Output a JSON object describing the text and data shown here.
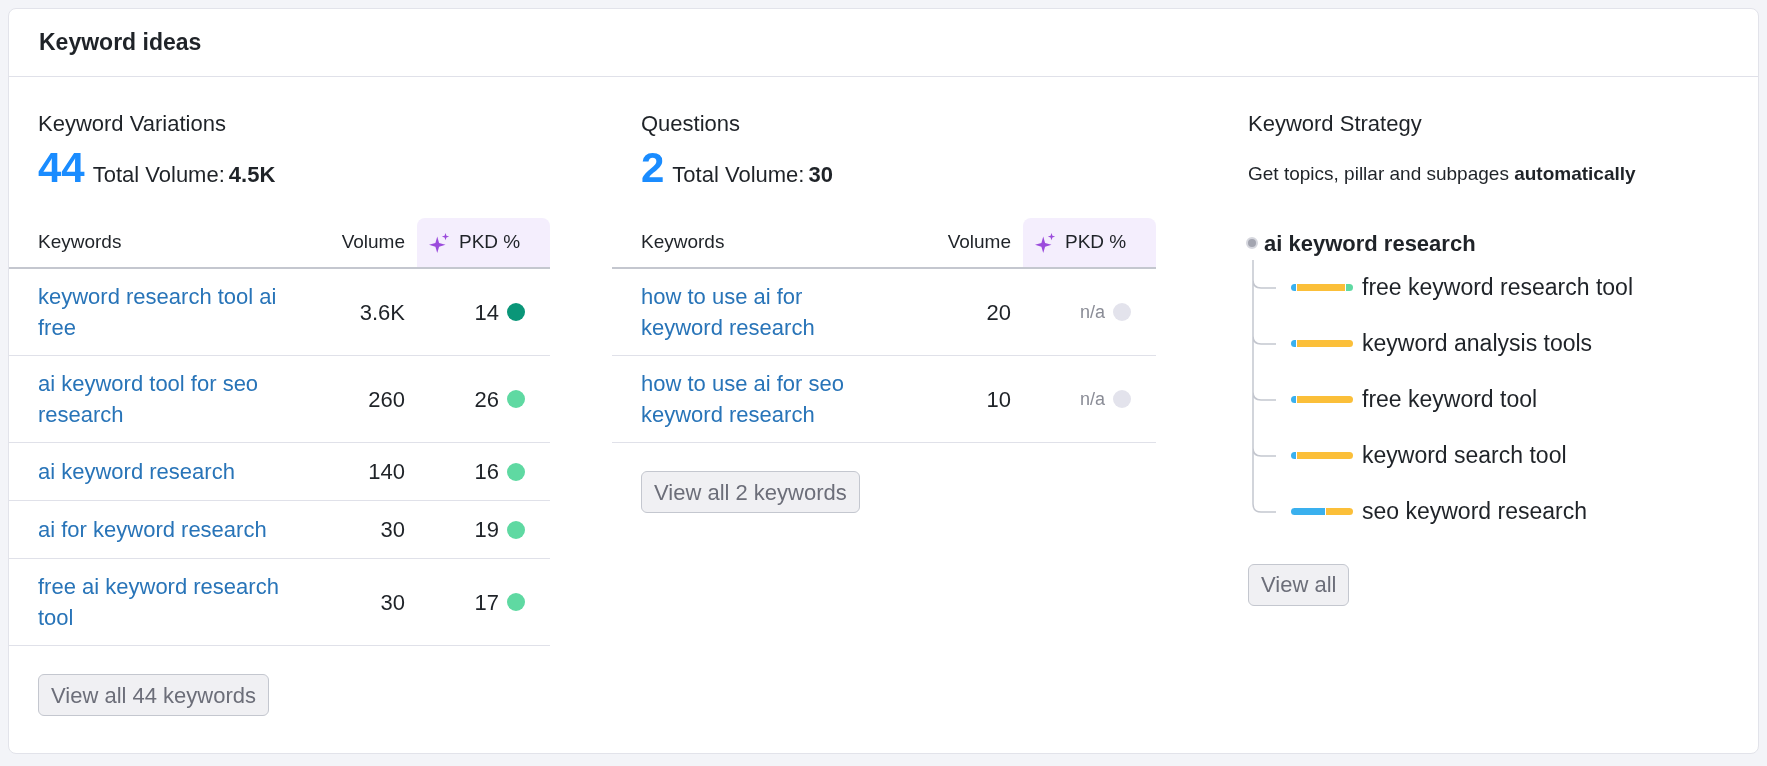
{
  "title": "Keyword ideas",
  "variations": {
    "title": "Keyword Variations",
    "count": "44",
    "volume_label": "Total Volume:",
    "volume": "4.5K",
    "columns": [
      "Keywords",
      "Volume",
      "PKD %"
    ],
    "rows": [
      {
        "keyword": "keyword research tool ai free",
        "volume": "3.6K",
        "pkd": "14",
        "color": "#0a9678"
      },
      {
        "keyword": "ai keyword tool for seo research",
        "volume": "260",
        "pkd": "26",
        "color": "#5fd9a2"
      },
      {
        "keyword": "ai keyword research",
        "volume": "140",
        "pkd": "16",
        "color": "#5fd9a2"
      },
      {
        "keyword": "ai for keyword research",
        "volume": "30",
        "pkd": "19",
        "color": "#5fd9a2"
      },
      {
        "keyword": "free ai keyword research tool",
        "volume": "30",
        "pkd": "17",
        "color": "#5fd9a2"
      }
    ],
    "button": "View all 44 keywords"
  },
  "questions": {
    "title": "Questions",
    "count": "2",
    "volume_label": "Total Volume:",
    "volume": "30",
    "columns": [
      "Keywords",
      "Volume",
      "PKD %"
    ],
    "rows": [
      {
        "keyword": "how to use ai for keyword research",
        "volume": "20",
        "pkd": "n/a",
        "color": "#e3e3ec"
      },
      {
        "keyword": "how to use ai for seo keyword research",
        "volume": "10",
        "pkd": "n/a",
        "color": "#e3e3ec"
      }
    ],
    "button": "View all 2 keywords"
  },
  "strategy": {
    "title": "Keyword Strategy",
    "description": "Get topics, pillar and subpages **automatically**",
    "tree": {
      "label": "ai keyword research",
      "children": [
        {
          "label": "free keyword research tool",
          "segments": [
            {
              "color": "#3ab0ee",
              "level": 0.08
            },
            {
              "color": "#fbbf39",
              "level": 0.8
            },
            {
              "color": "#5fd9a2",
              "level": 0.12
            }
          ]
        },
        {
          "label": "keyword analysis tools",
          "segments": [
            {
              "color": "#3ab0ee",
              "level": 0.08
            },
            {
              "color": "#fbbf39",
              "level": 0.92
            }
          ]
        },
        {
          "label": "free keyword tool",
          "segments": [
            {
              "color": "#3ab0ee",
              "level": 0.08
            },
            {
              "color": "#fbbf39",
              "level": 0.92
            }
          ]
        },
        {
          "label": "keyword search tool",
          "segments": [
            {
              "color": "#3ab0ee",
              "level": 0.08
            },
            {
              "color": "#fbbf39",
              "level": 0.92
            }
          ]
        },
        {
          "label": "seo keyword research",
          "segments": [
            {
              "color": "#3ab0ee",
              "level": 0.55
            },
            {
              "color": "#fbbf39",
              "level": 0.45
            }
          ]
        }
      ]
    },
    "button": "View all"
  }
}
